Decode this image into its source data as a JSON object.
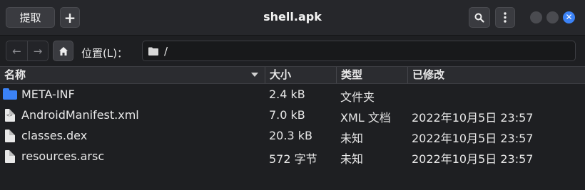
{
  "header": {
    "extract_label": "提取",
    "add_label": "+",
    "title": "shell.apk",
    "search_icon": "search-icon",
    "menu_icon": "kebab-menu-icon",
    "close_glyph": "✕"
  },
  "location": {
    "back_glyph": "←",
    "forward_glyph": "→",
    "label": "位置(L)：",
    "path": "/"
  },
  "columns": {
    "name": "名称",
    "size": "大小",
    "type": "类型",
    "modified": "已修改"
  },
  "files": [
    {
      "name": "META-INF",
      "size": "2.4 kB",
      "type": "文件夹",
      "modified": "",
      "icon": "folder-icon"
    },
    {
      "name": "AndroidManifest.xml",
      "size": "7.0 kB",
      "type": "XML 文档",
      "modified": "2022年10月5日 23:57",
      "icon": "xml-file-icon"
    },
    {
      "name": "classes.dex",
      "size": "20.3 kB",
      "type": "未知",
      "modified": "2022年10月5日 23:57",
      "icon": "file-icon"
    },
    {
      "name": "resources.arsc",
      "size": "572 字节",
      "type": "未知",
      "modified": "2022年10月5日 23:57",
      "icon": "file-icon"
    }
  ],
  "colors": {
    "accent": "#3b82f6",
    "background": "#1e1f22",
    "headerbar": "#26272b"
  }
}
